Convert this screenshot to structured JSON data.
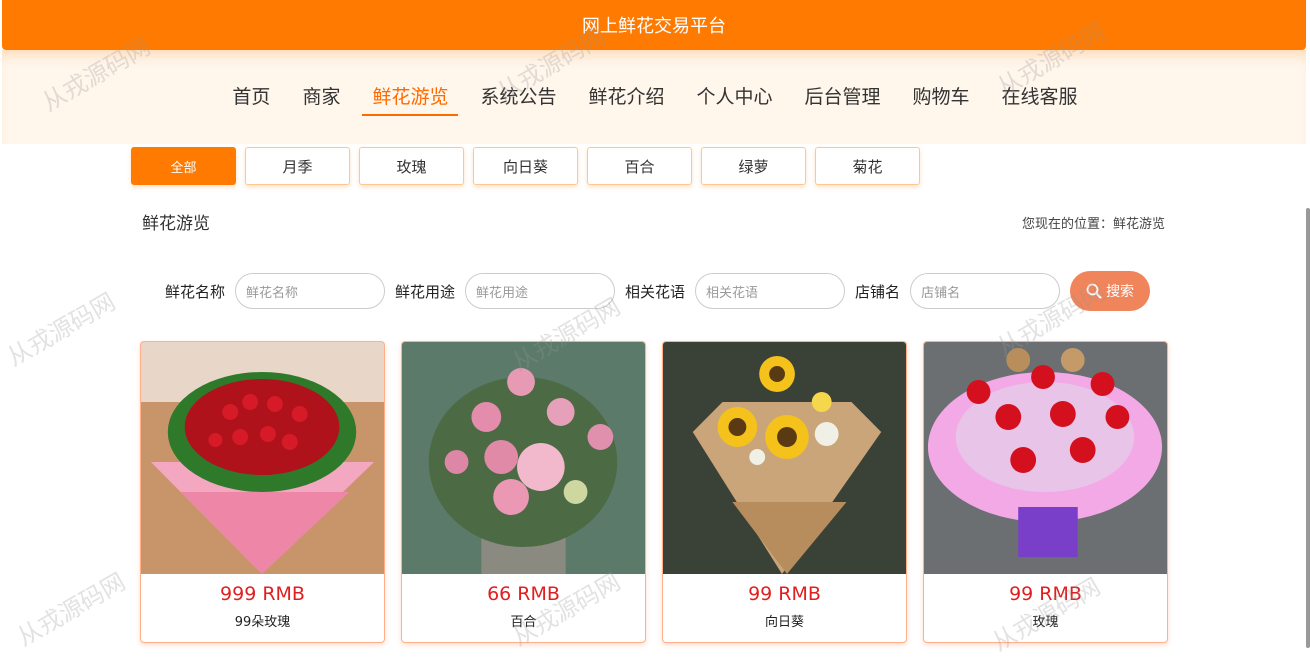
{
  "header": {
    "title": "网上鲜花交易平台"
  },
  "nav": {
    "items": [
      {
        "label": "首页"
      },
      {
        "label": "商家"
      },
      {
        "label": "鲜花游览"
      },
      {
        "label": "系统公告"
      },
      {
        "label": "鲜花介绍"
      },
      {
        "label": "个人中心"
      },
      {
        "label": "后台管理"
      },
      {
        "label": "购物车"
      },
      {
        "label": "在线客服"
      }
    ],
    "active_index": 2
  },
  "categories": {
    "items": [
      {
        "label": "全部"
      },
      {
        "label": "月季"
      },
      {
        "label": "玫瑰"
      },
      {
        "label": "向日葵"
      },
      {
        "label": "百合"
      },
      {
        "label": "绿萝"
      },
      {
        "label": "菊花"
      }
    ],
    "active_index": 0
  },
  "page": {
    "title": "鲜花游览",
    "breadcrumb": "您现在的位置：鲜花游览"
  },
  "search": {
    "fields": [
      {
        "label": "鲜花名称",
        "placeholder": "鲜花名称"
      },
      {
        "label": "鲜花用途",
        "placeholder": "鲜花用途"
      },
      {
        "label": "相关花语",
        "placeholder": "相关花语"
      },
      {
        "label": "店铺名",
        "placeholder": "店铺名"
      }
    ],
    "button_label": "搜索"
  },
  "products": [
    {
      "price": "999 RMB",
      "name": "99朵玫瑰",
      "image": "red-rose-bouquet"
    },
    {
      "price": "66 RMB",
      "name": "百合",
      "image": "pink-flower-vase"
    },
    {
      "price": "99 RMB",
      "name": "向日葵",
      "image": "sunflower-bouquet"
    },
    {
      "price": "99 RMB",
      "name": "玫瑰",
      "image": "rose-bouquet-bears"
    }
  ],
  "watermark": "从戎源码网",
  "colors": {
    "brand": "#ff7a00",
    "accent": "#ff6a00",
    "price": "#e02020",
    "search_button": "#f0845a"
  }
}
